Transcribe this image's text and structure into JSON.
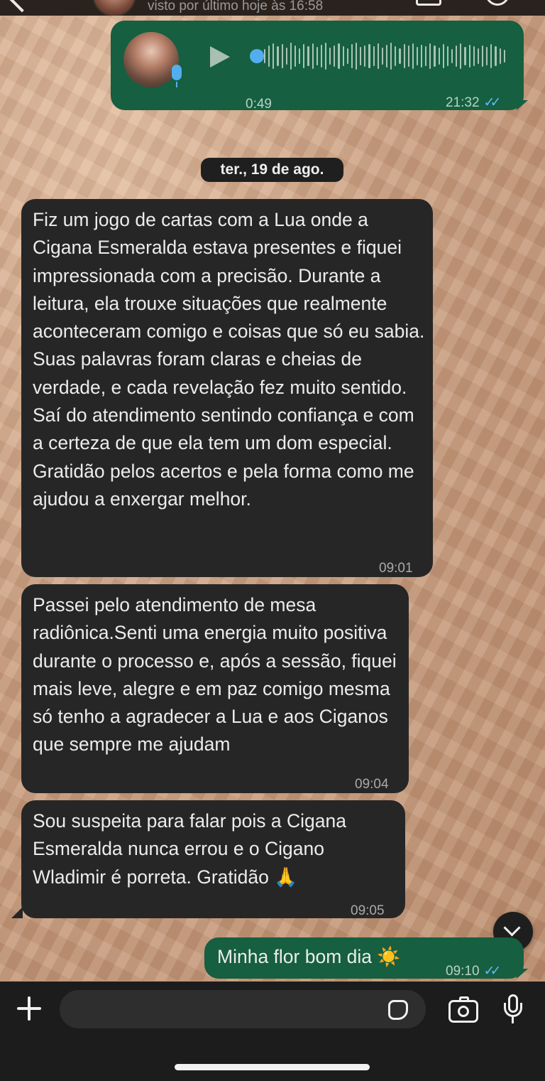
{
  "header": {
    "status": "visto por último hoje às 16:58"
  },
  "voice_message": {
    "duration": "0:49",
    "time": "21:32",
    "progress": 0
  },
  "date_separator": "ter., 19 de ago.",
  "messages": [
    {
      "direction": "incoming",
      "text": "Fiz um jogo de cartas com a Lua onde a Cigana Esmeralda estava presentes e fiquei impressionada com a precisão. Durante a leitura, ela trouxe situações que realmente aconteceram comigo e coisas que só eu sabia. Suas palavras foram claras e cheias de verdade, e cada revelação fez muito sentido. Saí do atendimento sentindo confiança e com a certeza de que ela tem um dom especial. Gratidão pelos acertos e pela forma como me ajudou a enxergar melhor.",
      "time": "09:01"
    },
    {
      "direction": "incoming",
      "text": "Passei pelo atendimento de mesa radiônica.Senti uma energia muito positiva durante o processo e, após a sessão, fiquei mais leve, alegre e em paz comigo mesma só tenho a agradecer a Lua e aos Ciganos que sempre me ajudam",
      "time": "09:04"
    },
    {
      "direction": "incoming",
      "text": "Sou suspeita para falar pois a Cigana Esmeralda nunca errou e o Cigano Wladimir é porreta. Gratidão 🙏",
      "time": "09:05"
    },
    {
      "direction": "outgoing",
      "text": "Minha flor bom dia ☀️",
      "time": "09:10"
    }
  ],
  "composer": {
    "placeholder": ""
  },
  "colors": {
    "incoming_bubble": "#262626",
    "outgoing_bubble": "#165f40",
    "read_ticks": "#60b8f5",
    "accent": "#53aeee"
  }
}
